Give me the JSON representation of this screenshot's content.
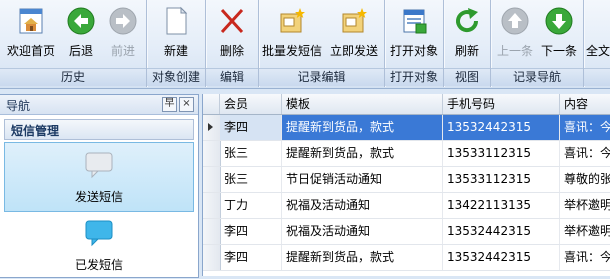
{
  "ribbon": {
    "groups": {
      "history": "历史",
      "create": "对象创建",
      "edit": "编辑",
      "record_edit": "记录编辑",
      "open_object": "打开对象",
      "view": "视图",
      "record_nav": "记录导航"
    },
    "buttons": {
      "home": "欢迎首页",
      "back": "后退",
      "forward": "前进",
      "new": "新建",
      "delete": "删除",
      "bulk_sms": "批量发短信",
      "send_now": "立即发送",
      "open_object": "打开对象",
      "refresh": "刷新",
      "prev": "上一条",
      "next": "下一条",
      "fulltext": "全文"
    }
  },
  "nav": {
    "title": "导航",
    "pin": "早",
    "close": "×",
    "section": "短信管理",
    "items": [
      {
        "label": "发送短信"
      },
      {
        "label": "已发短信"
      }
    ]
  },
  "grid": {
    "columns": [
      "会员",
      "模板",
      "手机号码",
      "内容"
    ],
    "rows": [
      {
        "member": "李四",
        "template": "提醒新到货品，款式",
        "phone": "13532442315",
        "content": "喜讯：今"
      },
      {
        "member": "张三",
        "template": "提醒新到货品，款式",
        "phone": "13533112315",
        "content": "喜讯：今"
      },
      {
        "member": "张三",
        "template": "节日促销活动通知",
        "phone": "13533112315",
        "content": "尊敬的张"
      },
      {
        "member": "丁力",
        "template": "祝福及活动通知",
        "phone": "13422113135",
        "content": "举杯邀明"
      },
      {
        "member": "李四",
        "template": "祝福及活动通知",
        "phone": "13532442315",
        "content": "举杯邀明"
      },
      {
        "member": "李四",
        "template": "提醒新到货品，款式",
        "phone": "13532442315",
        "content": "喜讯：今"
      }
    ]
  },
  "colors": {
    "selected_cell": "#3a79d6",
    "nav_selected": "#bfe3f8",
    "ribbon": "#dfe9f6"
  }
}
